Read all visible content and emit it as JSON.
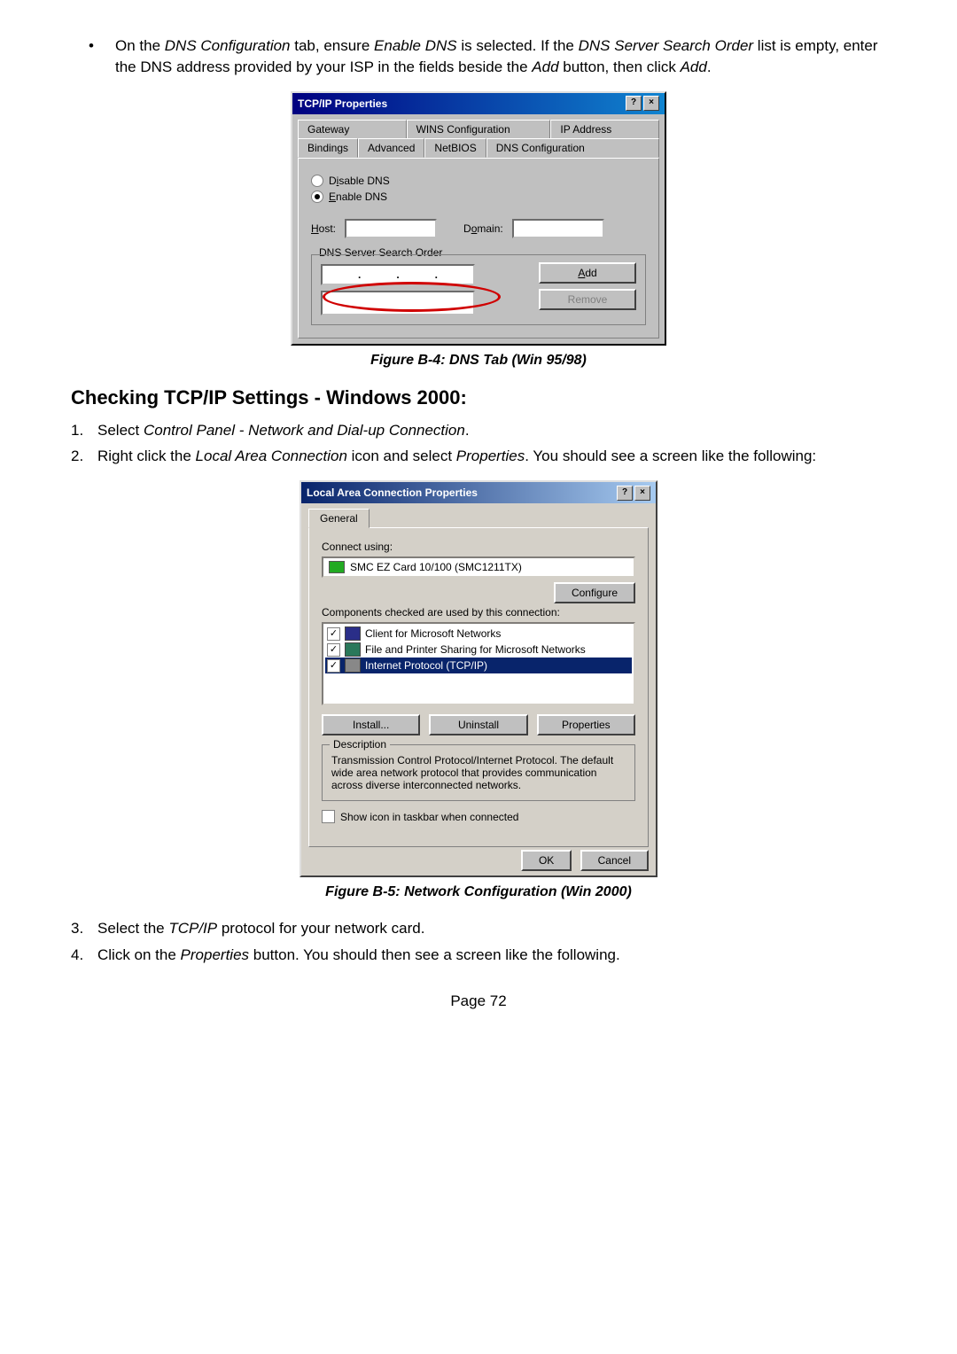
{
  "intro": {
    "bullet_text_prefix": "On the ",
    "bullet_dns_conf": "DNS Configuration",
    "bullet_text_mid1": " tab, ensure ",
    "bullet_enable_dns": "Enable DNS",
    "bullet_text_mid2": " is selected. If the ",
    "bullet_search_order": "DNS Server Search Order",
    "bullet_text_mid3": " list is empty, enter the DNS address provided by your ISP in the fields beside the ",
    "bullet_add": "Add",
    "bullet_text_end": " button, then click ",
    "bullet_add2": "Add",
    "bullet_period": "."
  },
  "dlg9x": {
    "title": "TCP/IP Properties",
    "tabs_back": [
      "Gateway",
      "WINS Configuration",
      "IP Address"
    ],
    "tabs_front": [
      "Bindings",
      "Advanced",
      "NetBIOS",
      "DNS Configuration"
    ],
    "radio_disable": "Disable DNS",
    "radio_enable": "Enable DNS",
    "host_label": "Host:",
    "domain_label": "Domain:",
    "search_label": "DNS Server Search Order",
    "add_btn": "Add",
    "remove_btn": "Remove"
  },
  "caption1": "Figure B-4: DNS Tab (Win 95/98)",
  "heading": "Checking TCP/IP Settings - Windows 2000:",
  "steps": {
    "s1_num": "1.",
    "s1_pre": "Select ",
    "s1_it": "Control Panel - Network and Dial-up Connection",
    "s1_end": ".",
    "s2_num": "2.",
    "s2_pre": "Right click the ",
    "s2_it1": "Local Area Connection",
    "s2_mid": " icon and select ",
    "s2_it2": "Properties",
    "s2_end": ". You should see a screen like the following:"
  },
  "dlg2k": {
    "title": "Local Area Connection Properties",
    "tab": "General",
    "connect_using": "Connect using:",
    "nic": "SMC EZ Card 10/100 (SMC1211TX)",
    "configure": "Configure",
    "components_label": "Components checked are used by this connection:",
    "comp1": "Client for Microsoft Networks",
    "comp2": "File and Printer Sharing for Microsoft Networks",
    "comp3": "Internet Protocol (TCP/IP)",
    "install": "Install...",
    "uninstall": "Uninstall",
    "properties": "Properties",
    "desc_label": "Description",
    "desc_text": "Transmission Control Protocol/Internet Protocol. The default wide area network protocol that provides communication across diverse interconnected networks.",
    "show_icon": "Show icon in taskbar when connected",
    "ok": "OK",
    "cancel": "Cancel"
  },
  "caption2": "Figure B-5: Network Configuration (Win 2000)",
  "steps2": {
    "s3_num": "3.",
    "s3_pre": "Select the ",
    "s3_it": "TCP/IP",
    "s3_end": " protocol for your network card.",
    "s4_num": "4.",
    "s4_pre": "Click on the ",
    "s4_it": "Properties",
    "s4_end": " button. You should then see a screen like the following."
  },
  "page_num": "Page 72"
}
